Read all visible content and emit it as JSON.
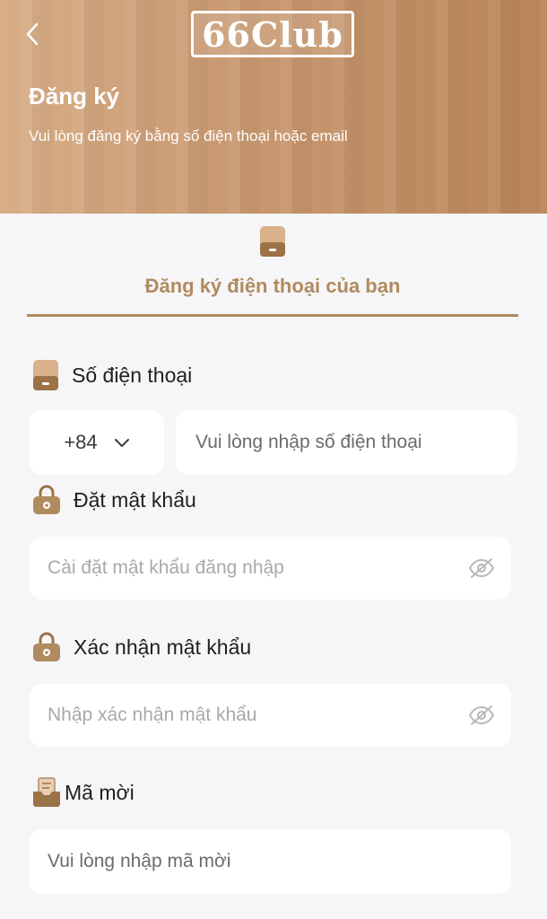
{
  "header": {
    "logo_text": "66Club",
    "title": "Đăng ký",
    "subtitle": "Vui lòng đăng ký bằng số điện thoại hoặc email"
  },
  "tab": {
    "label": "Đăng ký điện thoại của bạn",
    "icon": "phone-icon"
  },
  "phone": {
    "label": "Số điện thoại",
    "country_code": "+84",
    "placeholder": "Vui lòng nhập số điện thoại"
  },
  "password": {
    "label": "Đặt mật khẩu",
    "placeholder": "Cài đặt mật khẩu đăng nhập"
  },
  "confirm_password": {
    "label": "Xác nhận mật khẩu",
    "placeholder": "Nhập xác nhận mật khẩu"
  },
  "invite": {
    "label": "Mã mời",
    "placeholder": "Vui lòng nhập mã mời"
  },
  "colors": {
    "accent": "#b08b5f",
    "header_start": "#d8ae87",
    "header_end": "#b98558",
    "background": "#f6f6f8",
    "placeholder": "#a8a8ad"
  }
}
